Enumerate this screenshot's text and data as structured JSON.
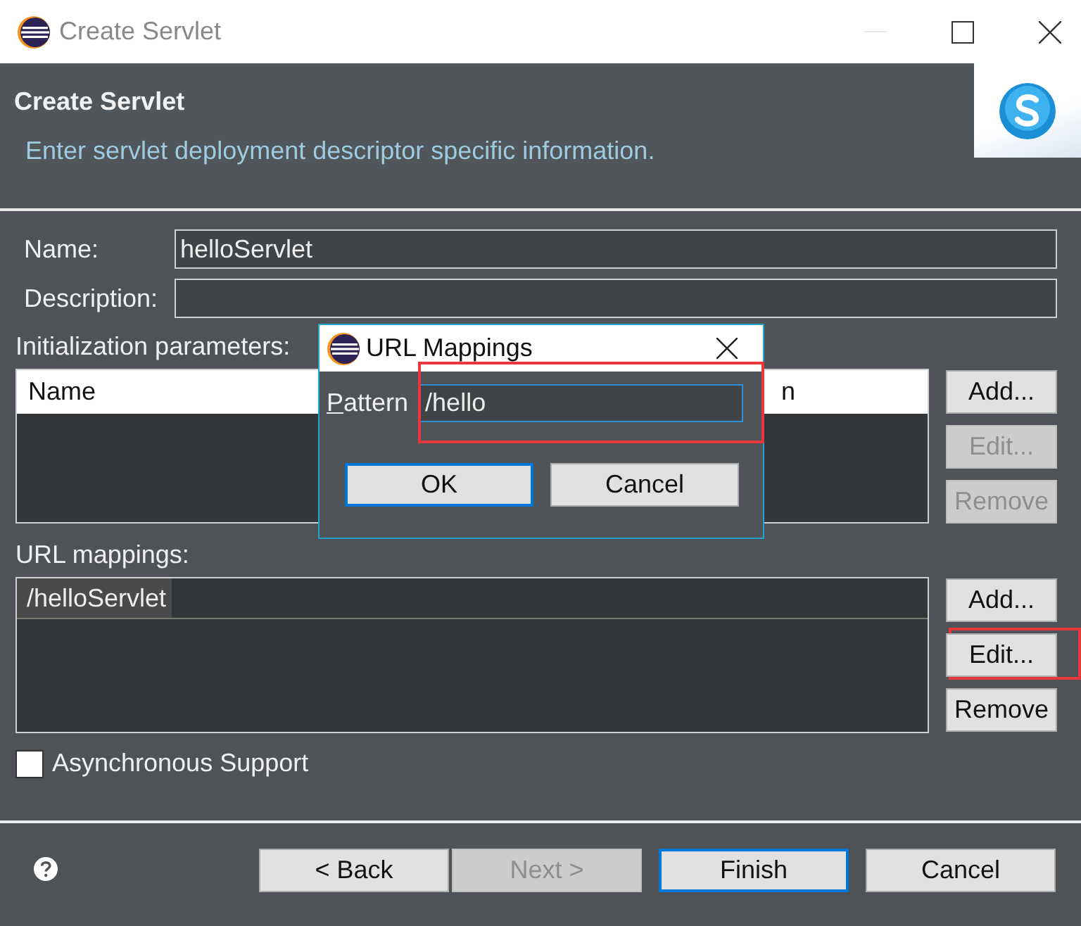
{
  "window": {
    "title": "Create Servlet"
  },
  "header": {
    "title": "Create Servlet",
    "description": "Enter servlet deployment descriptor specific information."
  },
  "fields": [
    {
      "label": "Name:",
      "value": "helloServlet"
    },
    {
      "label": "Description:"
    }
  ],
  "init_parameters": {
    "label": "Initialization parameters:",
    "columns": [
      "Name",
      "n"
    ],
    "buttons": [
      {
        "label": "Add...",
        "disabled": false,
        "highlighted": false
      },
      {
        "label": "Edit...",
        "disabled": true,
        "highlighted": false
      },
      {
        "label": "Remove",
        "disabled": true,
        "highlighted": false
      }
    ]
  },
  "url_mappings": {
    "label": "URL mappings:",
    "rows": [
      {
        "text": "/helloServlet",
        "selected": true
      }
    ],
    "buttons": [
      {
        "label": "Add...",
        "disabled": false,
        "highlighted": false
      },
      {
        "label": "Edit...",
        "disabled": false,
        "highlighted": true
      },
      {
        "label": "Remove",
        "disabled": false,
        "highlighted": false
      }
    ]
  },
  "async_support": {
    "label": "Asynchronous Support",
    "checked": false
  },
  "footer_buttons": [
    {
      "label": "< Back",
      "disabled": false,
      "default": false
    },
    {
      "label": "Next >",
      "disabled": true,
      "default": false
    },
    {
      "label": "Finish",
      "disabled": false,
      "default": true
    },
    {
      "label": "Cancel",
      "disabled": false,
      "default": false
    }
  ],
  "dialog": {
    "title": "URL Mappings",
    "pattern_label": "Pattern",
    "pattern_value": "/hello",
    "highlighted": true,
    "buttons": [
      {
        "label": "OK",
        "default": true
      },
      {
        "label": "Cancel",
        "default": false
      }
    ]
  }
}
